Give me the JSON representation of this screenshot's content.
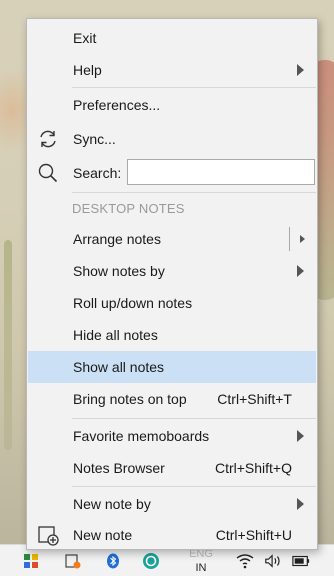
{
  "menu": {
    "exit": "Exit",
    "help": "Help",
    "preferences": "Preferences...",
    "sync": "Sync...",
    "search_label": "Search:",
    "search_value": "",
    "section_desktop_notes": "DESKTOP NOTES",
    "arrange_notes": "Arrange notes",
    "show_notes_by": "Show notes by",
    "roll_up_down": "Roll up/down notes",
    "hide_all": "Hide all notes",
    "show_all": "Show all notes",
    "bring_on_top": "Bring notes on top",
    "bring_on_top_shortcut": "Ctrl+Shift+T",
    "favorite_memoboards": "Favorite memoboards",
    "notes_browser": "Notes Browser",
    "notes_browser_shortcut": "Ctrl+Shift+Q",
    "new_note_by": "New note by",
    "new_note": "New note",
    "new_note_shortcut": "Ctrl+Shift+U",
    "highlighted_item": "Show all notes"
  },
  "taskbar": {
    "language_top": "ENG",
    "language_bottom": "IN"
  },
  "icons": {
    "sync": "sync-icon",
    "search": "search-icon",
    "new_note": "new-note-icon"
  },
  "colors": {
    "menu_bg": "#f2f2f2",
    "highlight": "#cce0f5",
    "section_header": "#9a9a9a"
  }
}
